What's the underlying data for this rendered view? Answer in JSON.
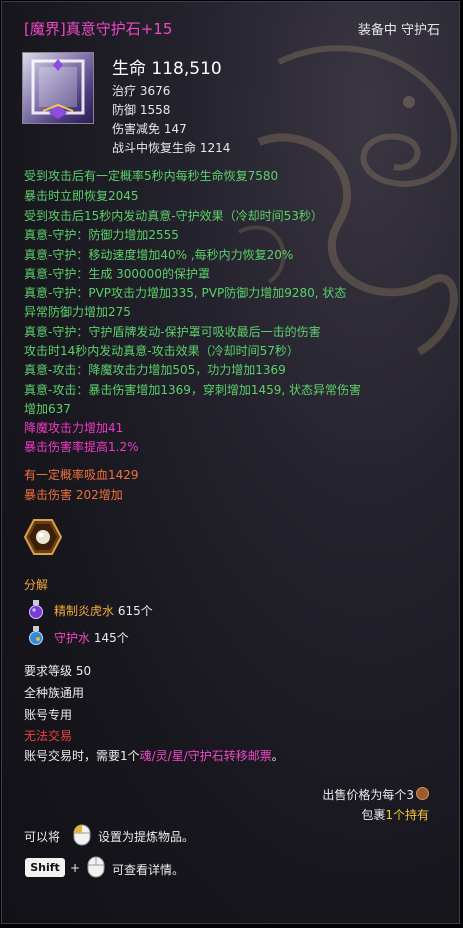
{
  "title": "[魔界]真意守护石+15",
  "status": "装备中  守护石",
  "stats": {
    "main": "生命 118,510",
    "lines": [
      "治疗 3676",
      "防御 1558",
      "伤害减免 147",
      "战斗中恢复生命 1214"
    ]
  },
  "effects_green": [
    "受到攻击后有一定概率5秒内每秒生命恢复7580",
    "暴击时立即恢复2045",
    "受到攻击后15秒内发动真意-守护效果（冷却时间53秒）",
    "真意-守护：防御力增加2555",
    "真意-守护：移动速度增加40% ,每秒内力恢复20%",
    "真意-守护：生成 300000的保护罩",
    "真意-守护：PVP攻击力增加335, PVP防御力增加9280, 状态",
    "异常防御力增加275",
    "真意-守护：守护盾牌发动-保护罩可吸收最后一击的伤害",
    "攻击时14秒内发动真意-攻击效果（冷却时间57秒）",
    "真意-攻击：降魔攻击力增加505，功力增加1369",
    "真意-攻击：暴击伤害增加1369，穿刺增加1459, 状态异常伤害",
    "增加637"
  ],
  "effects_pink": [
    "降魔攻击力增加41",
    "暴击伤害率提高1.2%"
  ],
  "effects_orange": [
    "有一定概率吸血1429",
    "暴击伤害 202增加"
  ],
  "decompose": {
    "label": "分解",
    "items": [
      {
        "name": "精制炎虎水",
        "count": "615个",
        "icon": "potion-icon"
      },
      {
        "name": "守护水",
        "count": "145个",
        "icon": "guard-water-icon"
      }
    ]
  },
  "requirements": [
    "要求等级 50",
    "全种族通用",
    "账号专用"
  ],
  "no_trade": "无法交易",
  "account_trade": {
    "prefix": "账号交易时，需要1个",
    "highlight": "魂/灵/星/守护石转移邮票",
    "suffix": "。"
  },
  "price": {
    "label": "出售价格为每个3",
    "icon": "coin-icon"
  },
  "inventory": {
    "label": "包裹",
    "count": "1个持有"
  },
  "refine_hint": {
    "prefix": "可以将",
    "suffix": "设置为提炼物品。"
  },
  "detail_hint": {
    "key": "Shift",
    "plus": "+",
    "suffix": "可查看详情。"
  }
}
